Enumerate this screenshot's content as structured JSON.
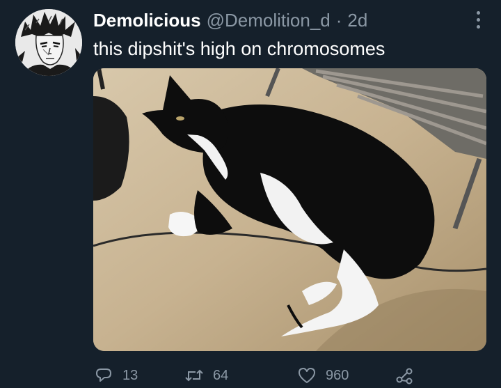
{
  "tweet": {
    "author_name": "Demolicious",
    "handle": "@Demolition_d",
    "separator": "·",
    "time": "2d",
    "text": "this dipshit's high on chromosomes"
  },
  "actions": {
    "reply_count": "13",
    "retweet_count": "64",
    "like_count": "960"
  },
  "icons": {
    "reply": "reply-icon",
    "retweet": "retweet-icon",
    "like": "heart-icon",
    "share": "share-icon",
    "more": "more-options-icon"
  },
  "colors": {
    "background": "#15202b",
    "primary_text": "#ffffff",
    "secondary_text": "#8b98a5"
  }
}
